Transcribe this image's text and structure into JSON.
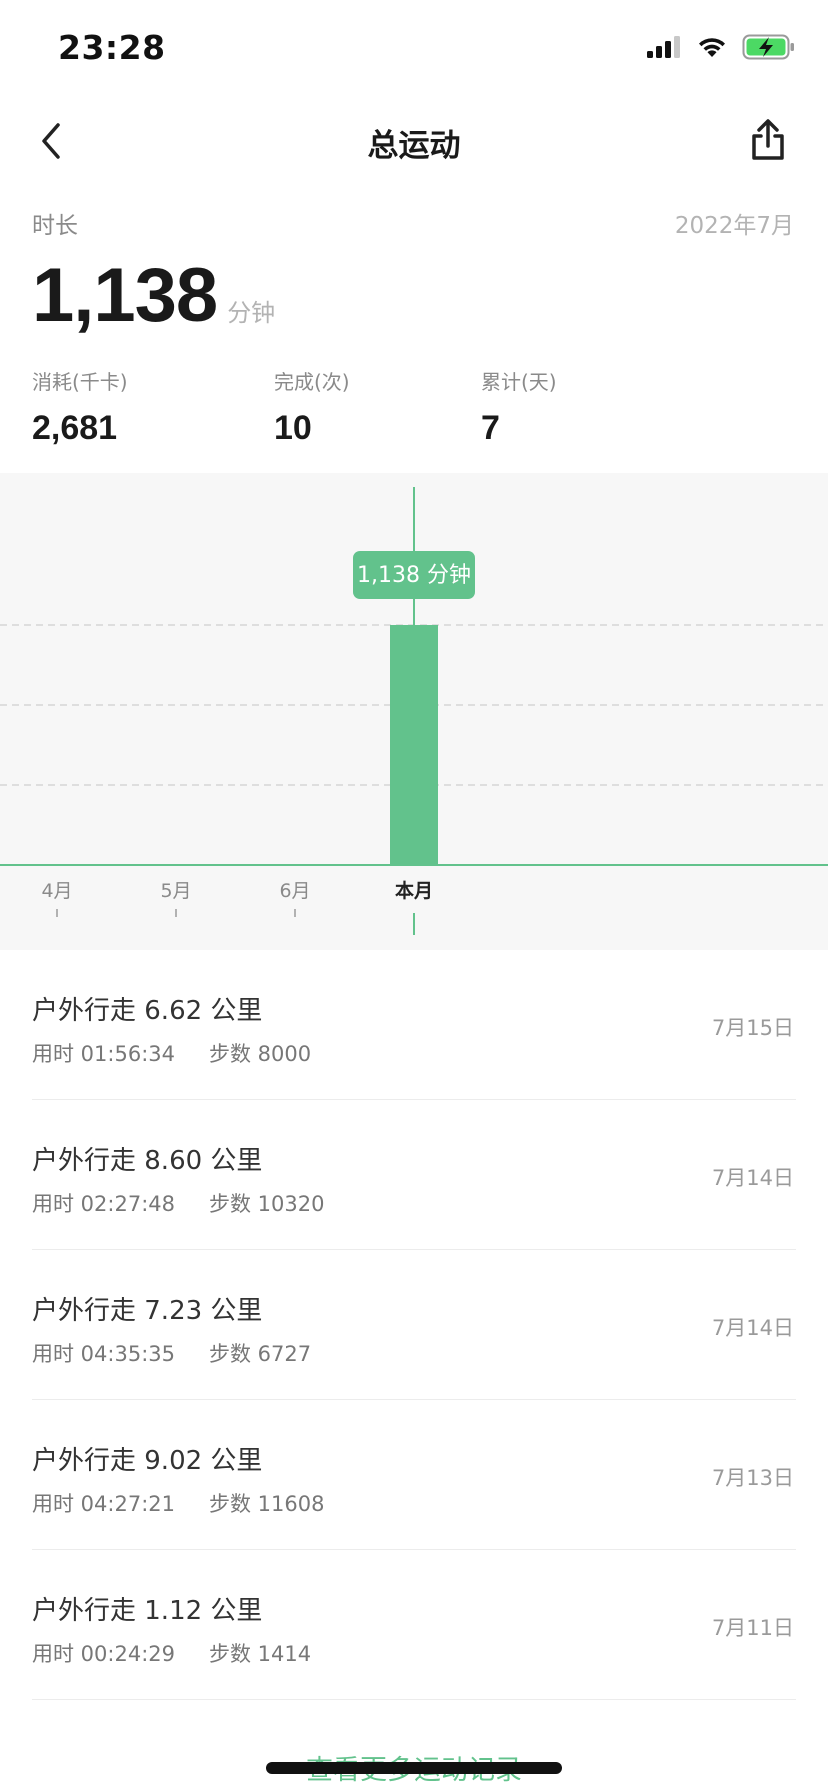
{
  "status_bar": {
    "time": "23:28"
  },
  "nav": {
    "title": "总运动"
  },
  "summary": {
    "metric_label": "时长",
    "period": "2022年7月",
    "value": "1,138",
    "unit": "分钟",
    "stats": [
      {
        "label": "消耗(千卡)",
        "value": "2,681"
      },
      {
        "label": "完成(次)",
        "value": "10"
      },
      {
        "label": "累计(天)",
        "value": "7"
      }
    ]
  },
  "chart_data": {
    "type": "bar",
    "categories": [
      "4月",
      "5月",
      "6月",
      "本月"
    ],
    "values": [
      0,
      0,
      0,
      1138
    ],
    "title": "",
    "xlabel": "",
    "ylabel": "",
    "selected_index": 3,
    "tooltip": "1,138 分钟",
    "grid": true,
    "colors": {
      "bar": "#62c28c",
      "tooltip": "#62c28c",
      "axis": "#62c28c"
    }
  },
  "records": [
    {
      "title": "户外行走 6.62 公里",
      "duration": "用时 01:56:34",
      "steps": "步数 8000",
      "date": "7月15日"
    },
    {
      "title": "户外行走 8.60 公里",
      "duration": "用时 02:27:48",
      "steps": "步数 10320",
      "date": "7月14日"
    },
    {
      "title": "户外行走 7.23 公里",
      "duration": "用时 04:35:35",
      "steps": "步数 6727",
      "date": "7月14日"
    },
    {
      "title": "户外行走 9.02 公里",
      "duration": "用时 04:27:21",
      "steps": "步数 11608",
      "date": "7月13日"
    },
    {
      "title": "户外行走 1.12 公里",
      "duration": "用时 00:24:29",
      "steps": "步数 1414",
      "date": "7月11日"
    }
  ],
  "more_link": "查看更多运动记录",
  "colors": {
    "accent": "#62c28c",
    "text": "#1a1a1a",
    "muted": "#8a8a8a"
  }
}
